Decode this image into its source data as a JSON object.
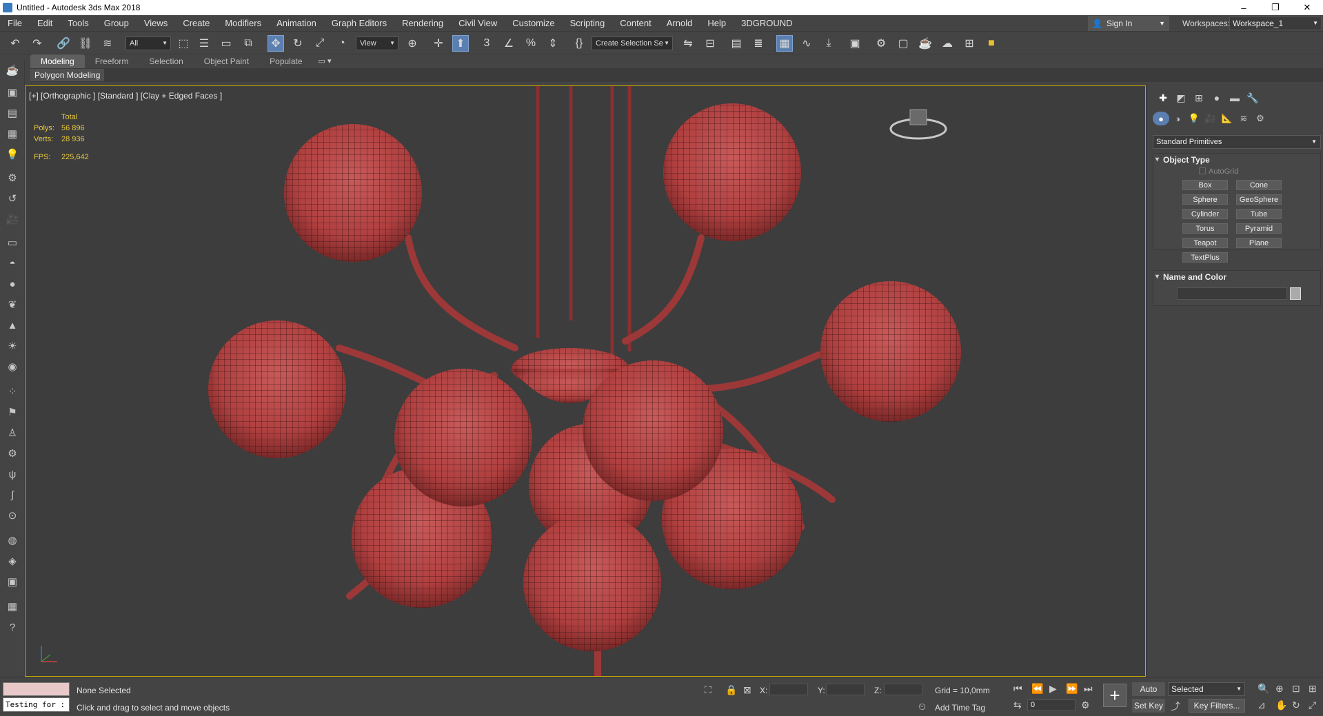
{
  "window": {
    "title": "Untitled - Autodesk 3ds Max 2018",
    "minimize": "–",
    "maximize": "❐",
    "close": "✕"
  },
  "menu": [
    "File",
    "Edit",
    "Tools",
    "Group",
    "Views",
    "Create",
    "Modifiers",
    "Animation",
    "Graph Editors",
    "Rendering",
    "Civil View",
    "Customize",
    "Scripting",
    "Content",
    "Arnold",
    "Help",
    "3DGROUND"
  ],
  "account": {
    "sign_in": "Sign In",
    "workspaces_label": "Workspaces:",
    "workspace_value": "Workspace_1"
  },
  "toolbar": {
    "filter_value": "All",
    "ref_coord_value": "View",
    "selection_set_value": "Create Selection Se"
  },
  "ribbon": {
    "tabs": [
      "Modeling",
      "Freeform",
      "Selection",
      "Object Paint",
      "Populate"
    ],
    "sub_label": "Polygon Modeling"
  },
  "viewport": {
    "label": "[+] [Orthographic ] [Standard ] [Clay + Edged Faces ]",
    "stats": {
      "total_label": "Total",
      "polys_label": "Polys:",
      "polys_value": "56 896",
      "verts_label": "Verts:",
      "verts_value": "28 936",
      "fps_label": "FPS:",
      "fps_value": "225,642"
    },
    "model_color": "#b54545",
    "border_color": "#c9a900"
  },
  "command_panel": {
    "category": "Standard Primitives",
    "object_type_title": "Object Type",
    "autogrid_label": "AutoGrid",
    "primitives": [
      "Box",
      "Cone",
      "Sphere",
      "GeoSphere",
      "Cylinder",
      "Tube",
      "Torus",
      "Pyramid",
      "Teapot",
      "Plane",
      "TextPlus"
    ],
    "name_color_title": "Name and Color"
  },
  "status": {
    "selection": "None Selected",
    "prompt": "Click and drag to select and move objects",
    "listener_text": "Testing for :",
    "x_label": "X:",
    "y_label": "Y:",
    "z_label": "Z:",
    "grid": "Grid = 10,0mm",
    "add_time_tag": "Add Time Tag",
    "auto_key": "Auto Key",
    "set_key": "Set Key",
    "key_mode_value": "Selected",
    "key_filters": "Key Filters...",
    "frame_value": "0"
  }
}
